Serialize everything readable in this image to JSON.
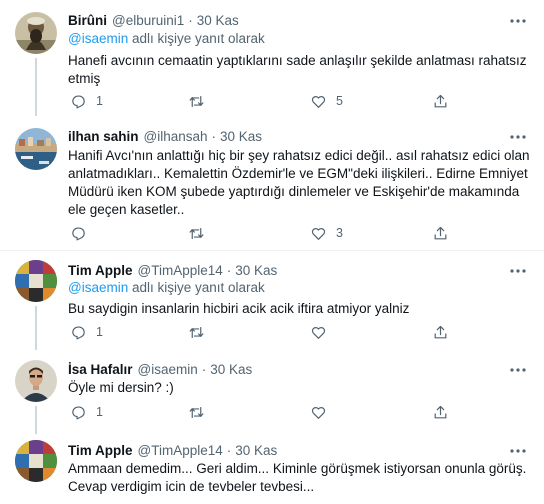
{
  "tweets": [
    {
      "name": "Birûni",
      "handle": "@elburuini1",
      "dot": "·",
      "time": "30 Kas",
      "replying_mention": "@isaemin",
      "replying_suffix": " adlı kişiye yanıt olarak",
      "text": "Hanefi avcının cemaatin yaptıklarını sade anlaşılır şekilde anlatması rahatsız etmiş",
      "reply_count": "1",
      "retweet_count": "",
      "like_count": "5",
      "avatar": "bearded-man-portrait"
    },
    {
      "name": "ilhan sahin",
      "handle": "@ilhansah",
      "dot": "·",
      "time": "30 Kas",
      "text": "Hanifi Avcı'nın anlattığı hiç bir şey rahatsız edici değil.. asıl rahatsız edici olan anlatmadıkları.. Kemalettin Özdemir'le ve EGM\"deki  ilişkileri.. Edirne Emniyet Müdürü iken KOM şubede yaptırdığı dinlemeler ve Eskişehir'de makamında ele geçen kasetler..",
      "reply_count": "",
      "retweet_count": "",
      "like_count": "3",
      "avatar": "harbor-landscape"
    },
    {
      "name": "Tim Apple",
      "handle": "@TimApple14",
      "dot": "·",
      "time": "30 Kas",
      "replying_mention": "@isaemin",
      "replying_suffix": " adlı kişiye yanıt olarak",
      "text": "Bu saydigin insanlarin hicbiri acik acik iftira atmiyor yalniz",
      "reply_count": "1",
      "retweet_count": "",
      "like_count": "",
      "avatar": "colorful-mosaic"
    },
    {
      "name": "İsa Hafalır",
      "handle": "@isaemin",
      "dot": "·",
      "time": "30 Kas",
      "text": "Öyle mi dersin? :)",
      "reply_count": "1",
      "retweet_count": "",
      "like_count": "",
      "avatar": "man-portrait"
    },
    {
      "name": "Tim Apple",
      "handle": "@TimApple14",
      "dot": "·",
      "time": "30 Kas",
      "text": "Ammaan demedim... Geri aldim... Kiminle görüşmek istiyorsan onunla görüş. Cevap verdigim icin de tevbeler tevbesi...",
      "reply_count": "",
      "retweet_count": "",
      "like_count": "",
      "avatar": "colorful-mosaic"
    }
  ],
  "icons": {
    "reply": "reply-icon",
    "retweet": "retweet-icon",
    "like": "heart-icon",
    "share": "share-icon",
    "more": "more-icon"
  },
  "colors": {
    "accent": "#1d9bf0",
    "text": "#0f1419",
    "secondary": "#536471",
    "divider": "#eff3f4",
    "thread_line": "#cfd9de"
  }
}
